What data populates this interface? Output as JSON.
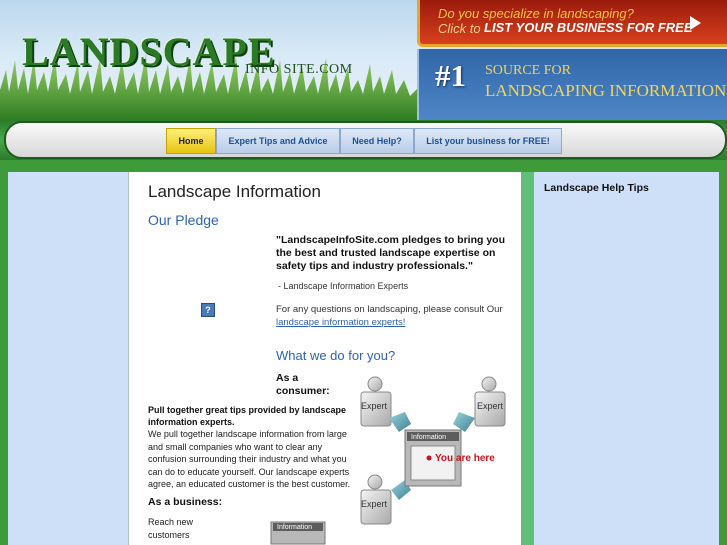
{
  "header": {
    "logo_main": "LANDSCAPE",
    "logo_sub": "INFO SITE.COM",
    "promo_line1": "Do you specialize in landscaping?",
    "promo_click": "Click to",
    "promo_cta": "LIST YOUR BUSINESS FOR FREE",
    "badge_number": "#1",
    "badge_line1": "SOURCE FOR",
    "badge_line2": "LANDSCAPING INFORMATION"
  },
  "nav": {
    "home": "Home",
    "expert": "Expert Tips and Advice",
    "help": "Need Help?",
    "list": "List your business for FREE!"
  },
  "main": {
    "title": "Landscape Information",
    "pledge_heading": "Our Pledge",
    "pledge_quote": "\"LandscapeInfoSite.com pledges to bring you the best and trusted landscape expertise on safety tips and industry professionals.\"",
    "pledge_attrib": "- Landscape Information Experts",
    "question_icon": "?",
    "consult_text": "For any questions on landscaping, please consult Our",
    "consult_link": "landscape information experts!",
    "what_heading": "What we do for you?",
    "consumer_heading": "As a consumer:",
    "consumer_bold": "Pull together great tips provided by landscape information experts.",
    "consumer_body": "We pull together landscape information from large and small companies who want to clear any confusion surrounding their industry and what you can do to educate yourself.  Our landscape experts agree, an educated customer is the best customer.",
    "business_heading": "As a business:",
    "business_body": "Reach new customers"
  },
  "diagram": {
    "expert_label": "Expert",
    "info_label": "Information",
    "you_are_here": "You are here"
  },
  "sidebar": {
    "title": "Landscape Help Tips"
  }
}
